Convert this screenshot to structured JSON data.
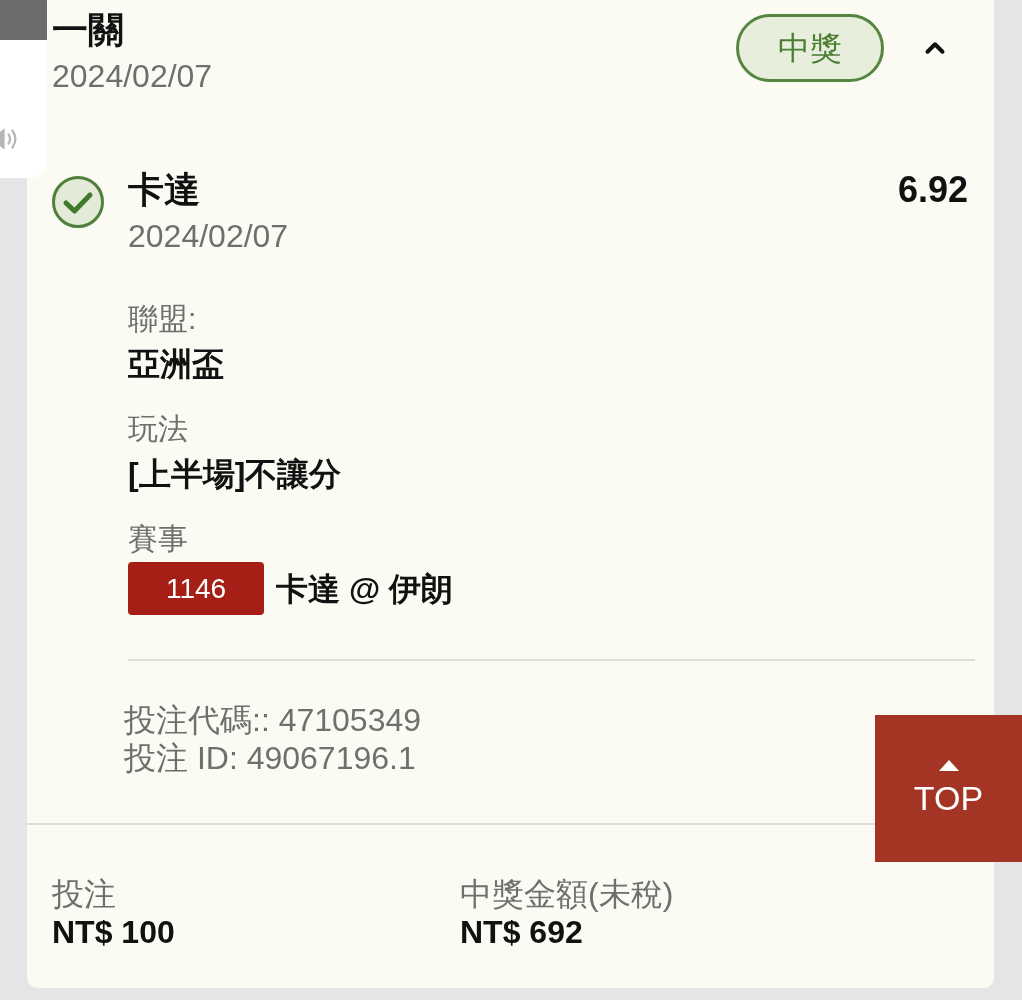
{
  "bet": {
    "title": "一關",
    "date": "2024/02/07",
    "status_badge": "中獎",
    "expanded": true
  },
  "legs": [
    {
      "won": true,
      "team": "卡達",
      "date": "2024/02/07",
      "odds": "6.92",
      "fields": [
        {
          "kind": "text",
          "label": "聯盟:",
          "value": "亞洲盃"
        },
        {
          "kind": "text",
          "label": "玩法",
          "value": "[上半場]不讓分"
        },
        {
          "kind": "match",
          "label": "賽事",
          "match_no": "1146",
          "value": "卡達 @ 伊朗"
        }
      ]
    }
  ],
  "bet_code": "投注代碼:: 47105349",
  "bet_id": "投注 ID: 49067196.1",
  "summary": [
    {
      "label": "投注",
      "value": "NT$ 100"
    },
    {
      "label": "中獎金額(未稅)",
      "value": "NT$ 692"
    }
  ],
  "top_button": {
    "label": "TOP"
  }
}
